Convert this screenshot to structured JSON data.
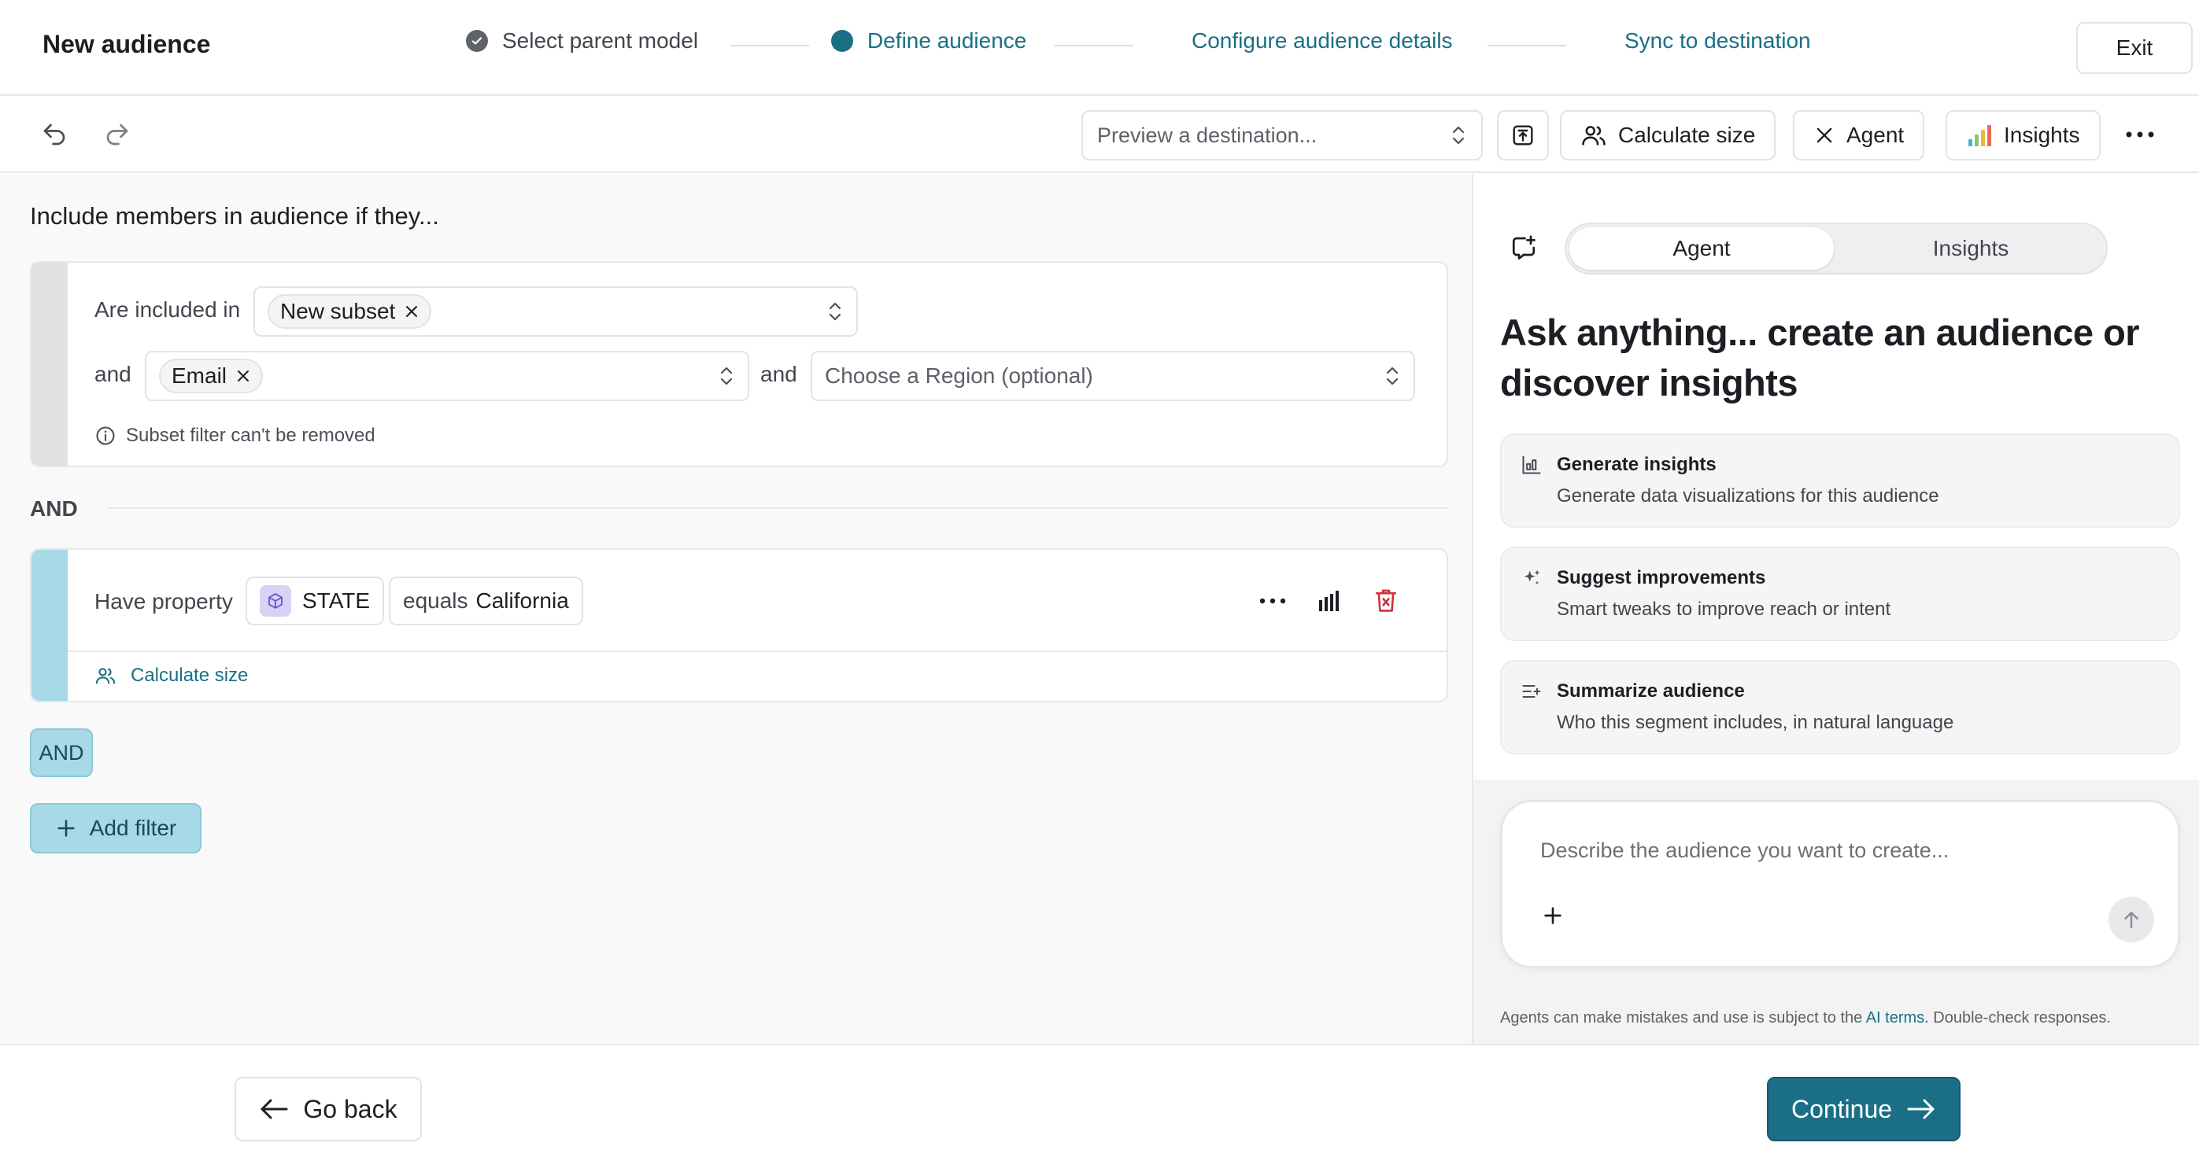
{
  "header": {
    "title": "New audience",
    "steps": [
      {
        "label": "Select parent model",
        "state": "completed"
      },
      {
        "label": "Define audience",
        "state": "current"
      },
      {
        "label": "Configure audience details",
        "state": "upcoming"
      },
      {
        "label": "Sync to destination",
        "state": "upcoming"
      }
    ],
    "exit_label": "Exit"
  },
  "toolbar": {
    "preview_placeholder": "Preview a destination...",
    "calculate_size_label": "Calculate size",
    "agent_label": "Agent",
    "insights_label": "Insights"
  },
  "builder": {
    "title": "Include members in audience if they...",
    "subset_card": {
      "label": "Are included in",
      "subset_chip": "New subset",
      "and_label_1": "and",
      "channel_chip": "Email",
      "and_label_2": "and",
      "region_placeholder": "Choose a Region (optional)",
      "info_text": "Subset filter can't be removed"
    },
    "and_divider_label": "AND",
    "property_card": {
      "label": "Have property",
      "property_name": "STATE",
      "operator": "equals",
      "value": "California",
      "calculate_size_label": "Calculate size"
    },
    "and_toggle_label": "AND",
    "add_filter_label": "Add filter"
  },
  "assistant": {
    "tabs": [
      {
        "label": "Agent",
        "active": true
      },
      {
        "label": "Insights",
        "active": false
      }
    ],
    "heading": "Ask anything... create an audience or discover insights",
    "suggestions": [
      {
        "icon": "bar-chart-icon",
        "title": "Generate insights",
        "description": "Generate data visualizations for this audience"
      },
      {
        "icon": "sparkle-icon",
        "title": "Suggest improvements",
        "description": "Smart tweaks to improve reach or intent"
      },
      {
        "icon": "summarize-icon",
        "title": "Summarize audience",
        "description": "Who this segment includes, in natural language"
      }
    ],
    "chat_placeholder": "Describe the audience you want to create...",
    "disclaimer_prefix": "Agents can make mistakes and use is subject to the ",
    "disclaimer_link": "AI terms.",
    "disclaimer_suffix": " Double-check responses."
  },
  "footer": {
    "back_label": "Go back",
    "continue_label": "Continue"
  },
  "colors": {
    "accent": "#1a6f86",
    "and_fill": "#a8d9e6",
    "delete_red": "#d0313c",
    "subset_bar": "#e2e0e0",
    "property_bar": "#a8d9e6"
  }
}
